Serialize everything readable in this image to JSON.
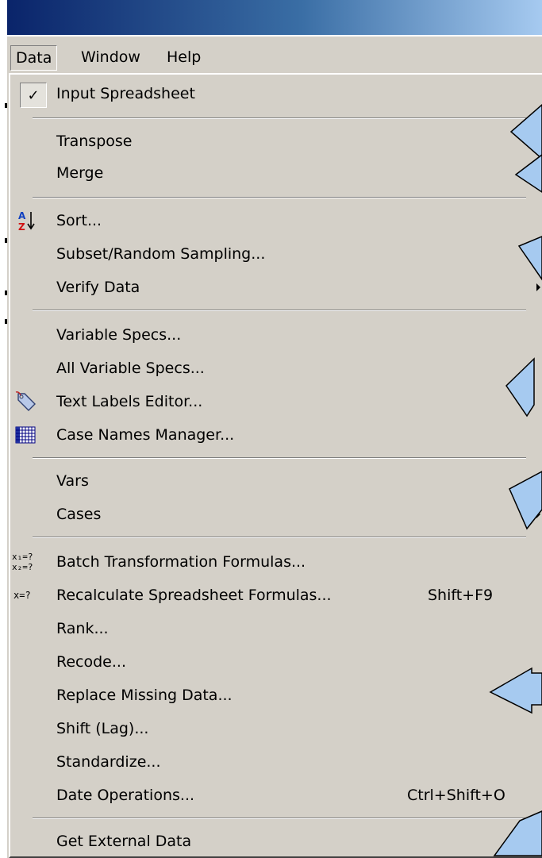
{
  "menubar": {
    "data": "Data",
    "window": "Window",
    "help": "Help"
  },
  "menu": {
    "input_spreadsheet": "Input Spreadsheet",
    "transpose": "Transpose",
    "merge": "Merge",
    "sort": "Sort...",
    "subset": "Subset/Random Sampling...",
    "verify": "Verify Data",
    "variable_specs": "Variable Specs...",
    "all_variable_specs": "All Variable Specs...",
    "text_labels_editor": "Text Labels Editor...",
    "case_names_manager": "Case Names Manager...",
    "vars": "Vars",
    "cases": "Cases",
    "batch_transformation": "Batch Transformation Formulas...",
    "recalculate": "Recalculate Spreadsheet Formulas...",
    "recalculate_shortcut": "Shift+F9",
    "rank": "Rank...",
    "recode": "Recode...",
    "replace_missing": "Replace Missing Data...",
    "shift_lag": "Shift (Lag)...",
    "standardize": "Standardize...",
    "date_operations": "Date Operations...",
    "date_operations_shortcut": "Ctrl+Shift+O",
    "get_external_data": "Get External Data"
  },
  "icons": {
    "check": "✓",
    "sort_az": "A Z ↓",
    "batch": "x₁=? x₂=?",
    "recalc": "x=?"
  },
  "colors": {
    "menu_bg": "#d4d0c8",
    "title_start": "#0a246a",
    "title_end": "#a6caf0",
    "callout_fill": "#a6caf0"
  }
}
